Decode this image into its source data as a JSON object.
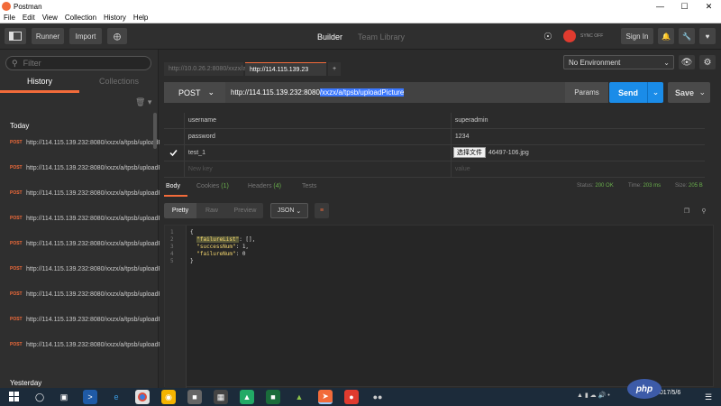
{
  "window": {
    "title": "Postman"
  },
  "menu": [
    "File",
    "Edit",
    "View",
    "Collection",
    "History",
    "Help"
  ],
  "toolbar": {
    "runner": "Runner",
    "import": "Import",
    "builder_tab": "Builder",
    "team_library_tab": "Team Library",
    "sync_status": "SYNC OFF",
    "sign_in": "Sign In"
  },
  "sidebar": {
    "filter_placeholder": "Filter",
    "tabs": [
      "History",
      "Collections"
    ],
    "groups": [
      {
        "label": "Today"
      },
      {
        "label": "Yesterday"
      }
    ],
    "history_items": [
      {
        "method": "POST",
        "url": "http://114.115.139.232:8080/xxzx/a/tpsb/uploadPicture"
      },
      {
        "method": "POST",
        "url": "http://114.115.139.232:8080/xxzx/a/tpsb/uploadPicture"
      },
      {
        "method": "POST",
        "url": "http://114.115.139.232:8080/xxzx/a/tpsb/uploadPicture"
      },
      {
        "method": "POST",
        "url": "http://114.115.139.232:8080/xxzx/a/tpsb/uploadPicture"
      },
      {
        "method": "POST",
        "url": "http://114.115.139.232:8080/xxzx/a/tpsb/uploadPicture"
      },
      {
        "method": "POST",
        "url": "http://114.115.139.232:8080/xxzx/a/tpsb/uploadPicture"
      },
      {
        "method": "POST",
        "url": "http://114.115.139.232:8080/xxzx/a/tpsb/uploadPicture"
      },
      {
        "method": "POST",
        "url": "http://114.115.139.232:8080/xxzx/a/tpsb/uploadPicture"
      },
      {
        "method": "POST",
        "url": "http://114.115.139.232:8080/xxzx/a/tpsb/uploadPicture"
      }
    ]
  },
  "request_tabs": [
    {
      "label": "http://10.0.26.2:8080/xxzx/a",
      "active": false
    },
    {
      "label": "http://114.115.139.23",
      "active": true
    }
  ],
  "environment": {
    "selected": "No Environment"
  },
  "request": {
    "method": "POST",
    "url_plain": "http://114.115.139.232:8080",
    "url_selected": "/xxzx/a/tpsb/uploadPicture",
    "params_label": "Params",
    "send_label": "Send",
    "save_label": "Save"
  },
  "form_rows": [
    {
      "key": "username",
      "value": "superadmin",
      "checked": false
    },
    {
      "key": "password",
      "value": "1234",
      "checked": false
    },
    {
      "key": "test_1",
      "file_button": "选择文件",
      "value": "46497-106.jpg",
      "checked": true
    },
    {
      "key_placeholder": "New key",
      "value_placeholder": "value"
    }
  ],
  "response": {
    "tabs": [
      {
        "label": "Body",
        "count": ""
      },
      {
        "label": "Cookies",
        "count": "(1)"
      },
      {
        "label": "Headers",
        "count": "(4)"
      },
      {
        "label": "Tests",
        "count": ""
      }
    ],
    "status_label": "Status:",
    "status_value": "200 OK",
    "time_label": "Time:",
    "time_value": "203 ms",
    "size_label": "Size:",
    "size_value": "205 B",
    "view_modes": [
      "Pretty",
      "Raw",
      "Preview"
    ],
    "format": "JSON",
    "code_lines": [
      {
        "n": "1",
        "text": "{"
      },
      {
        "n": "2",
        "key": "\"failureList\"",
        "rest": ": [],"
      },
      {
        "n": "3",
        "key": "\"successNum\"",
        "rest": ": 1,"
      },
      {
        "n": "4",
        "key": "\"failureNum\"",
        "rest": ": 0"
      },
      {
        "n": "5",
        "text": "}"
      }
    ]
  },
  "taskbar": {
    "time": "",
    "date": "2017/5/6"
  },
  "watermark": "php"
}
